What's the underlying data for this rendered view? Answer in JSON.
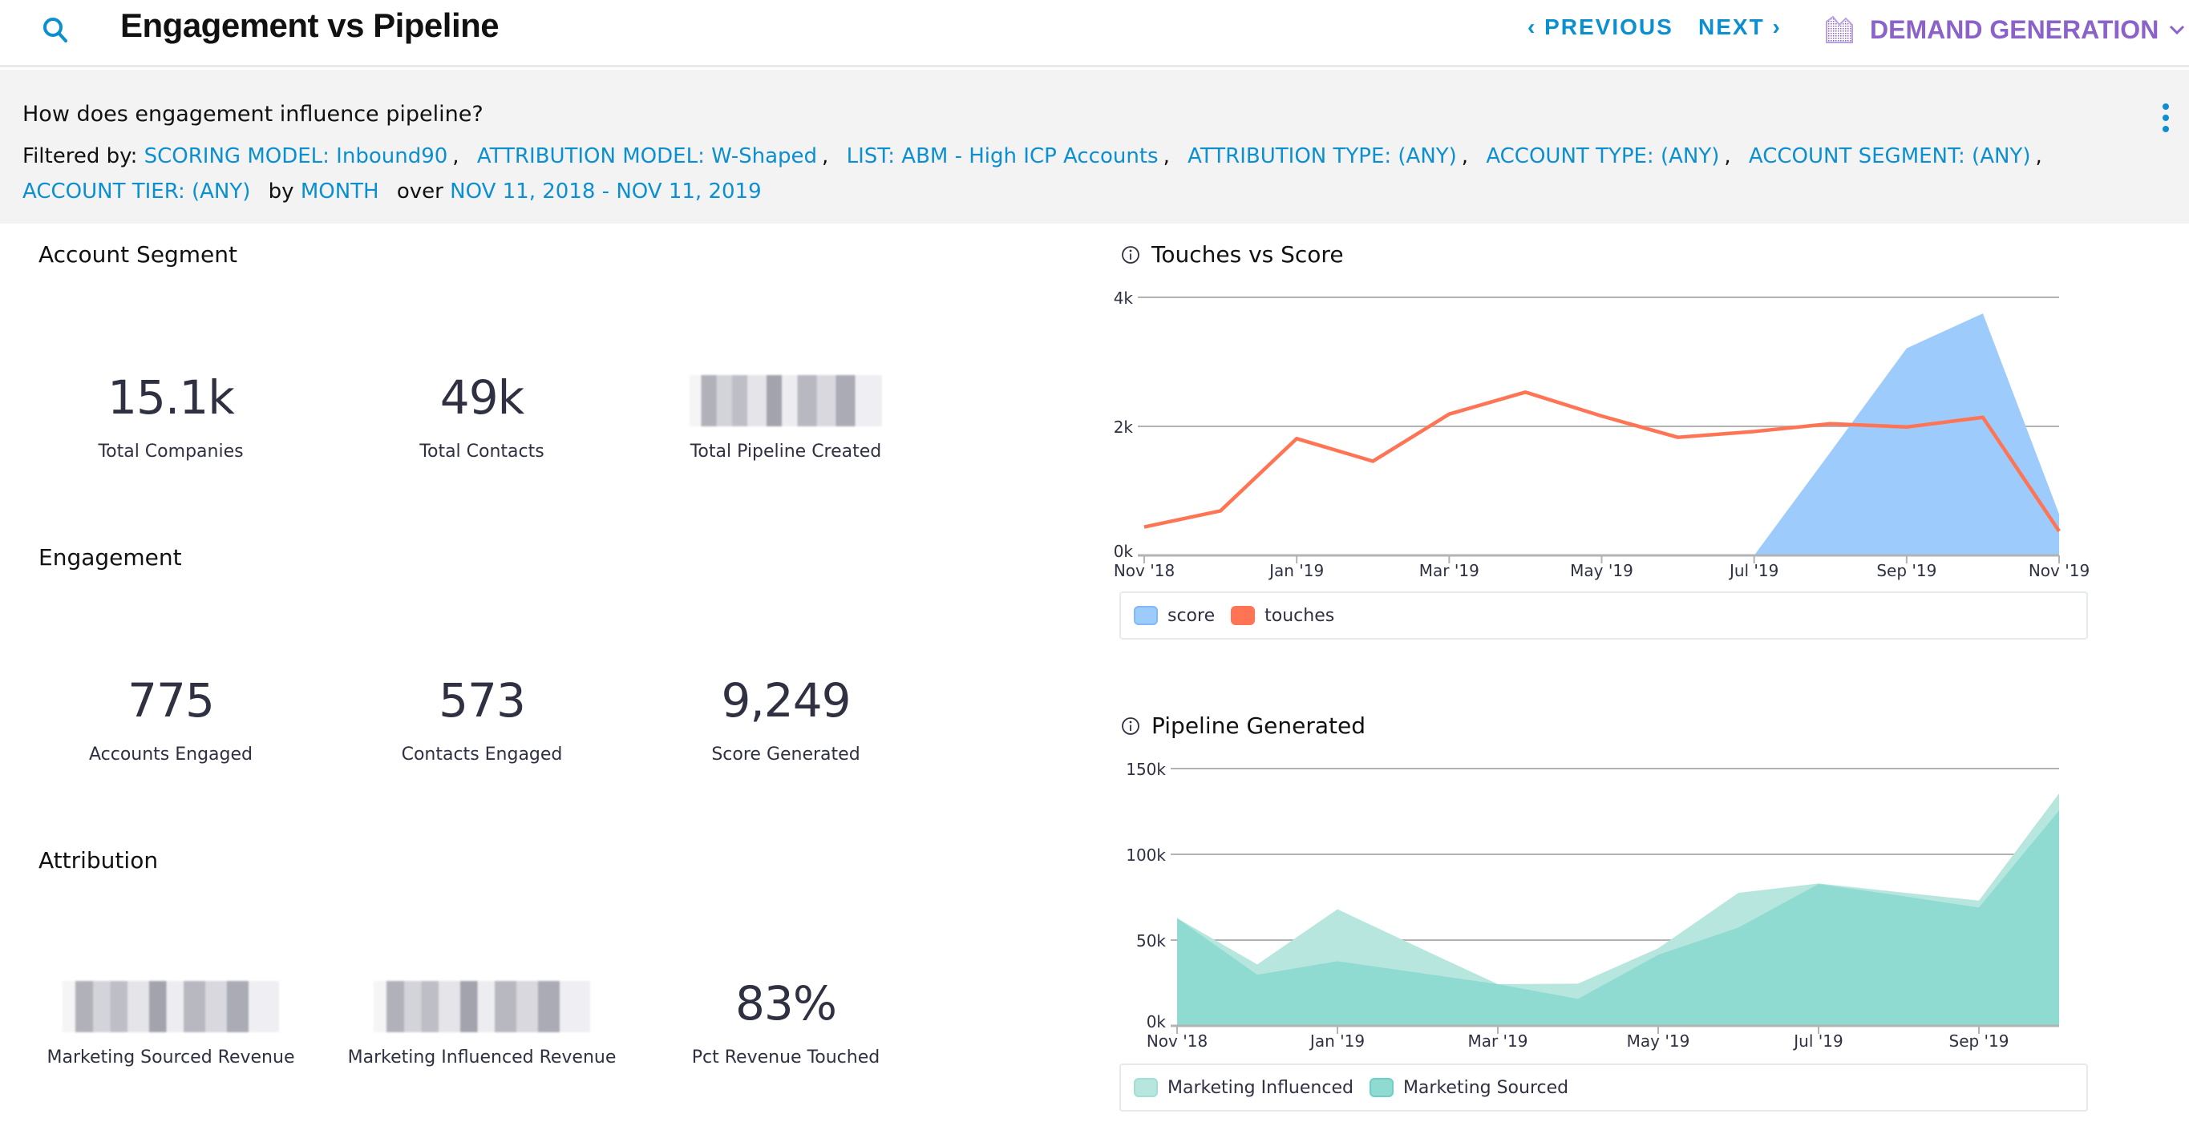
{
  "header": {
    "title": "Engagement vs Pipeline",
    "prev_label": "PREVIOUS",
    "next_label": "NEXT",
    "dashboard_label": "DEMAND GENERATION",
    "accent_color": "#0c8fd0",
    "dashboard_color": "#8a62c9"
  },
  "question": "How does engagement influence pipeline?",
  "filters": {
    "prefix": "Filtered by:",
    "items": [
      "SCORING MODEL: Inbound90",
      "ATTRIBUTION MODEL: W-Shaped",
      "LIST: ABM - High ICP Accounts",
      "ATTRIBUTION TYPE: (ANY)",
      "ACCOUNT TYPE: (ANY)",
      "ACCOUNT SEGMENT: (ANY)",
      "ACCOUNT TIER: (ANY)"
    ],
    "by_word": "by",
    "period": "MONTH",
    "over_word": "over",
    "range": "NOV 11, 2018 - NOV 11, 2019"
  },
  "sections": [
    {
      "title": "Account Segment",
      "metrics": [
        {
          "value": "15.1k",
          "label": "Total Companies",
          "redacted": false
        },
        {
          "value": "49k",
          "label": "Total Contacts",
          "redacted": false
        },
        {
          "value": "",
          "label": "Total Pipeline Created",
          "redacted": true
        }
      ]
    },
    {
      "title": "Engagement",
      "metrics": [
        {
          "value": "775",
          "label": "Accounts Engaged",
          "redacted": false
        },
        {
          "value": "573",
          "label": "Contacts Engaged",
          "redacted": false
        },
        {
          "value": "9,249",
          "label": "Score Generated",
          "redacted": false
        }
      ]
    },
    {
      "title": "Attribution",
      "metrics": [
        {
          "value": "",
          "label": "Marketing Sourced Revenue",
          "redacted": true
        },
        {
          "value": "",
          "label": "Marketing Influenced Revenue",
          "redacted": true
        },
        {
          "value": "83%",
          "label": "Pct Revenue Touched",
          "redacted": false
        }
      ]
    }
  ],
  "chart_data": [
    {
      "type": "area",
      "title": "Touches vs Score",
      "x": [
        "Nov '18",
        "Dec '18",
        "Jan '19",
        "Feb '19",
        "Mar '19",
        "Apr '19",
        "May '19",
        "Jun '19",
        "Jul '19",
        "Aug '19",
        "Sep '19",
        "Oct '19",
        "Nov '19"
      ],
      "x_tick_labels": [
        "Nov '18",
        "Jan '19",
        "Mar '19",
        "May '19",
        "Jul '19",
        "Sep '19",
        "Nov '19"
      ],
      "y_tick_labels": [
        "0k",
        "2k",
        "4k"
      ],
      "ylim": [
        0,
        4000
      ],
      "grid": true,
      "legend_position": "bottom",
      "series": [
        {
          "name": "score",
          "kind": "area",
          "color": "#9dcbfb",
          "values": [
            null,
            null,
            null,
            null,
            null,
            null,
            null,
            null,
            0,
            1600,
            3210,
            3750,
            640
          ]
        },
        {
          "name": "touches",
          "kind": "line",
          "color": "#ff7454",
          "values": [
            440,
            690,
            1810,
            1460,
            2190,
            2530,
            2160,
            1830,
            1920,
            2040,
            1990,
            2140,
            375
          ]
        }
      ]
    },
    {
      "type": "area",
      "title": "Pipeline Generated",
      "x": [
        "Nov '18",
        "Dec '18",
        "Jan '19",
        "Feb '19",
        "Mar '19",
        "Apr '19",
        "May '19",
        "Jun '19",
        "Jul '19",
        "Aug '19",
        "Sep '19",
        "Oct '19"
      ],
      "x_tick_labels": [
        "Nov '18",
        "Jan '19",
        "Mar '19",
        "May '19",
        "Jul '19",
        "Sep '19"
      ],
      "y_tick_labels": [
        "0k",
        "50k",
        "100k",
        "150k"
      ],
      "ylim": [
        0,
        150000
      ],
      "grid": true,
      "legend_position": "bottom",
      "series": [
        {
          "name": "Marketing Influenced",
          "kind": "area",
          "color": "#b7e6de",
          "values": [
            62800,
            35800,
            68000,
            46000,
            24300,
            24600,
            45200,
            77500,
            83000,
            78000,
            73000,
            135500
          ]
        },
        {
          "name": "Marketing Sourced",
          "kind": "area",
          "color": "#8fdbd2",
          "values": [
            62800,
            29800,
            37700,
            31000,
            24300,
            15700,
            41400,
            57300,
            82700,
            76000,
            69000,
            125600
          ]
        }
      ]
    }
  ]
}
